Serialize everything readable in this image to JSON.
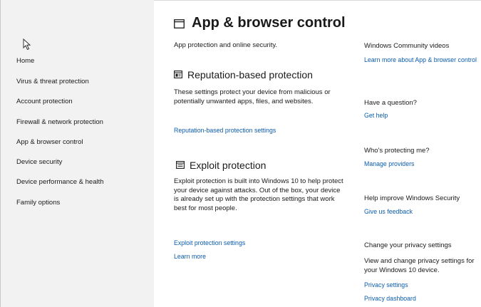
{
  "sidebar": {
    "items": [
      {
        "label": "Home"
      },
      {
        "label": "Virus & threat protection"
      },
      {
        "label": "Account protection"
      },
      {
        "label": "Firewall & network protection"
      },
      {
        "label": "App & browser control"
      },
      {
        "label": "Device security"
      },
      {
        "label": "Device performance & health"
      },
      {
        "label": "Family options"
      }
    ]
  },
  "main": {
    "title": "App & browser control",
    "subtitle": "App protection and online security.",
    "reputation": {
      "title": "Reputation-based protection",
      "body": "These settings protect your device from malicious or potentially unwanted apps, files, and websites.",
      "link": "Reputation-based protection settings"
    },
    "exploit": {
      "title": "Exploit protection",
      "body": "Exploit protection is built into Windows 10 to help protect your device against attacks.  Out of the box, your device is already set up with the protection settings that work best for most people.",
      "settings_link": "Exploit protection settings",
      "learn_more": "Learn more"
    }
  },
  "aside": {
    "videos": {
      "heading": "Windows Community videos",
      "link": "Learn more about App & browser control"
    },
    "question": {
      "heading": "Have a question?",
      "link": "Get help"
    },
    "protecting": {
      "heading": "Who's protecting me?",
      "link": "Manage providers"
    },
    "improve": {
      "heading": "Help improve Windows Security",
      "link": "Give us feedback"
    },
    "privacy": {
      "heading": "Change your privacy settings",
      "body": "View and change privacy settings for your Windows 10 device.",
      "link_settings": "Privacy settings",
      "link_dashboard": "Privacy dashboard"
    }
  },
  "colors": {
    "link": "#0b5cad",
    "sidebar_bg": "#f2f2f2"
  }
}
